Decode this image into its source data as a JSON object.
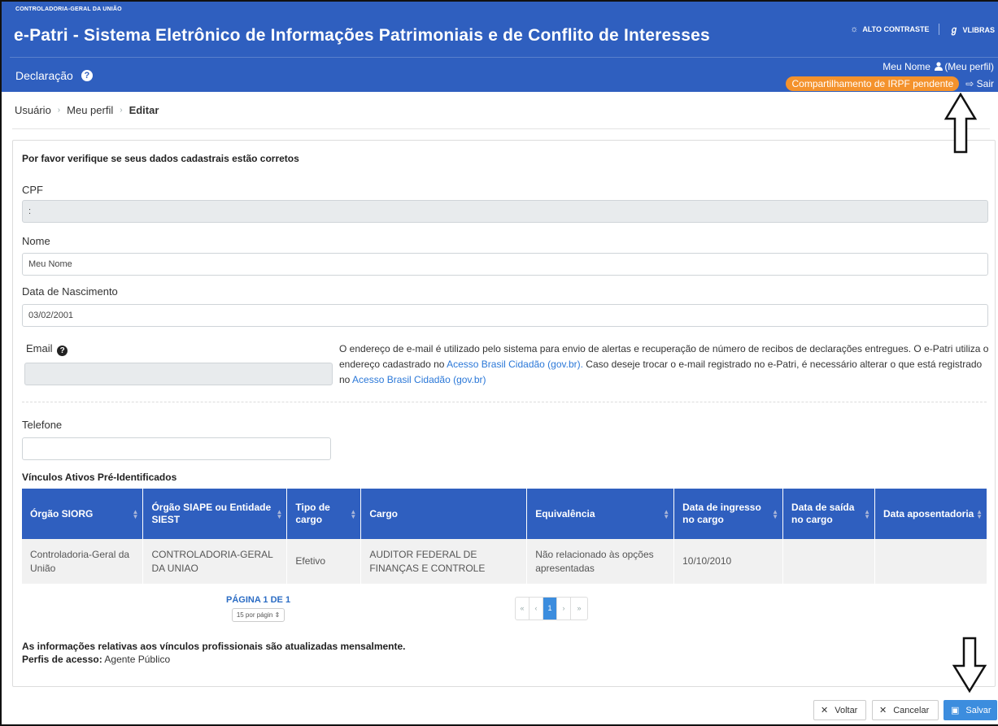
{
  "header": {
    "org": "CONTROLADORIA-GERAL DA UNIÃO",
    "title": "e-Patri - Sistema Eletrônico de Informações Patrimoniais e de Conflito de Interesses",
    "high_contrast": "ALTO CONTRASTE",
    "vlibras": "VLIBRAS",
    "section": "Declaração",
    "user_name": "Meu Nome",
    "user_profile": "(Meu perfil)",
    "pending_badge": "Compartilhamento de IRPF pendente",
    "logout": "Sair"
  },
  "breadcrumb": [
    "Usuário",
    "Meu perfil",
    "Editar"
  ],
  "form": {
    "intro": "Por favor verifique se seus dados cadastrais estão corretos",
    "cpf_label": "CPF",
    "cpf_value": ":",
    "nome_label": "Nome",
    "nome_value": "Meu Nome",
    "nasc_label": "Data de Nascimento",
    "nasc_value": "03/02/2001",
    "email_label": "Email",
    "email_value": "",
    "email_help_1": "O endereço de e-mail é utilizado pelo sistema para envio de alertas e recuperação de número de recibos de declarações entregues. O e-Patri utiliza o endereço cadastrado no ",
    "email_link_1": "Acesso Brasil Cidadão (gov.br).",
    "email_help_2": " Caso deseje trocar o e-mail registrado no e-Patri, é necessário alterar o que está registrado no ",
    "email_link_2": "Acesso Brasil Cidadão (gov.br)",
    "telefone_label": "Telefone",
    "telefone_value": ""
  },
  "vinculos": {
    "title": "Vínculos Ativos Pré-Identificados",
    "columns": [
      "Órgão SIORG",
      "Órgão SIAPE ou Entidade SIEST",
      "Tipo de cargo",
      "Cargo",
      "Equivalência",
      "Data de ingresso no cargo",
      "Data de saída no cargo",
      "Data aposentadoria"
    ],
    "rows": [
      [
        "Controladoria-Geral da União",
        "CONTROLADORIA-GERAL DA UNIAO",
        "Efetivo",
        "AUDITOR FEDERAL DE FINANÇAS E CONTROLE",
        "Não relacionado às opções apresentadas",
        "10/10/2010",
        "",
        ""
      ]
    ],
    "page_text": "PÁGINA 1 DE 1",
    "per_page": "15 por págin",
    "pager": [
      "«",
      "‹",
      "1",
      "›",
      "»"
    ],
    "current_page": "1"
  },
  "notes": {
    "monthly": "As informações relativas aos vínculos profissionais são atualizadas mensalmente.",
    "profiles_label": "Perfis de acesso:",
    "profiles_value": " Agente Público"
  },
  "buttons": {
    "voltar": "Voltar",
    "cancelar": "Cancelar",
    "salvar": "Salvar"
  },
  "colors": {
    "header_blue": "#2f5fbf",
    "badge_orange": "#f4922c",
    "link_blue": "#2b78d8",
    "primary_button": "#3c8dde"
  },
  "icons": [
    "contrast-icon",
    "vlibras-icon",
    "help-icon",
    "user-icon",
    "logout-icon",
    "sort-icon",
    "close-icon",
    "save-icon",
    "up-arrow-annotation",
    "down-arrow-annotation"
  ]
}
